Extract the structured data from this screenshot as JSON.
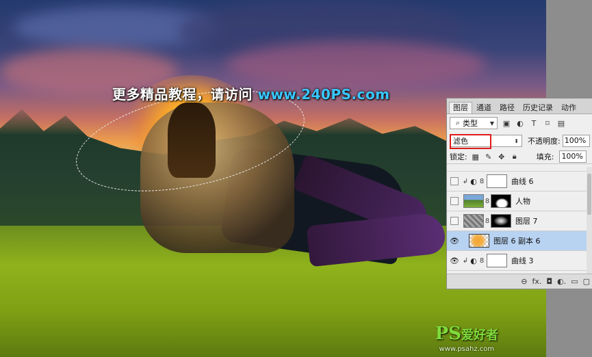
{
  "watermark": {
    "text": "更多精品教程，请访问",
    "url": "www.240PS.com"
  },
  "logo": {
    "mark": "PS",
    "mark_cn": "爱好者",
    "site": "www.psahz.com"
  },
  "panel": {
    "tabs": [
      "图层",
      "通道",
      "路径",
      "历史记录",
      "动作"
    ],
    "active_tab": "图层",
    "filter": {
      "value": "类型"
    },
    "filter_icons": [
      "image-filter-icon",
      "adjustment-filter-icon",
      "type-filter-icon",
      "shape-filter-icon",
      "smart-object-filter-icon"
    ],
    "filter_icon_glyphs": [
      "▣",
      "◐",
      "T",
      "⌑",
      "▤"
    ],
    "blend_mode": {
      "value": "滤色"
    },
    "opacity": {
      "label": "不透明度:",
      "value": "100%"
    },
    "lock": {
      "label": "锁定:"
    },
    "fill": {
      "label": "填充:",
      "value": "100%"
    },
    "layers": [
      {
        "name": "曲线 6",
        "visible": false,
        "clipped": true,
        "type": "adjustment"
      },
      {
        "name": "人物",
        "visible": false,
        "clipped": false,
        "type": "masked-photo"
      },
      {
        "name": "图层 7",
        "visible": false,
        "clipped": false,
        "type": "masked-cloud"
      },
      {
        "name": "图层 6 副本 6",
        "visible": true,
        "clipped": false,
        "type": "pixel",
        "selected": true
      },
      {
        "name": "曲线 3",
        "visible": true,
        "clipped": true,
        "type": "adjustment"
      }
    ],
    "bottom_icons": [
      "link-icon",
      "fx-icon",
      "mask-icon",
      "adjustment-icon",
      "folder-icon",
      "new-layer-icon"
    ],
    "bottom_glyphs": [
      "⊖",
      "fx.",
      "◘",
      "◐.",
      "▭",
      "▢"
    ],
    "colors": {
      "selected_row": "#b8d2f1",
      "highlight_box": "#e01a1a"
    }
  }
}
